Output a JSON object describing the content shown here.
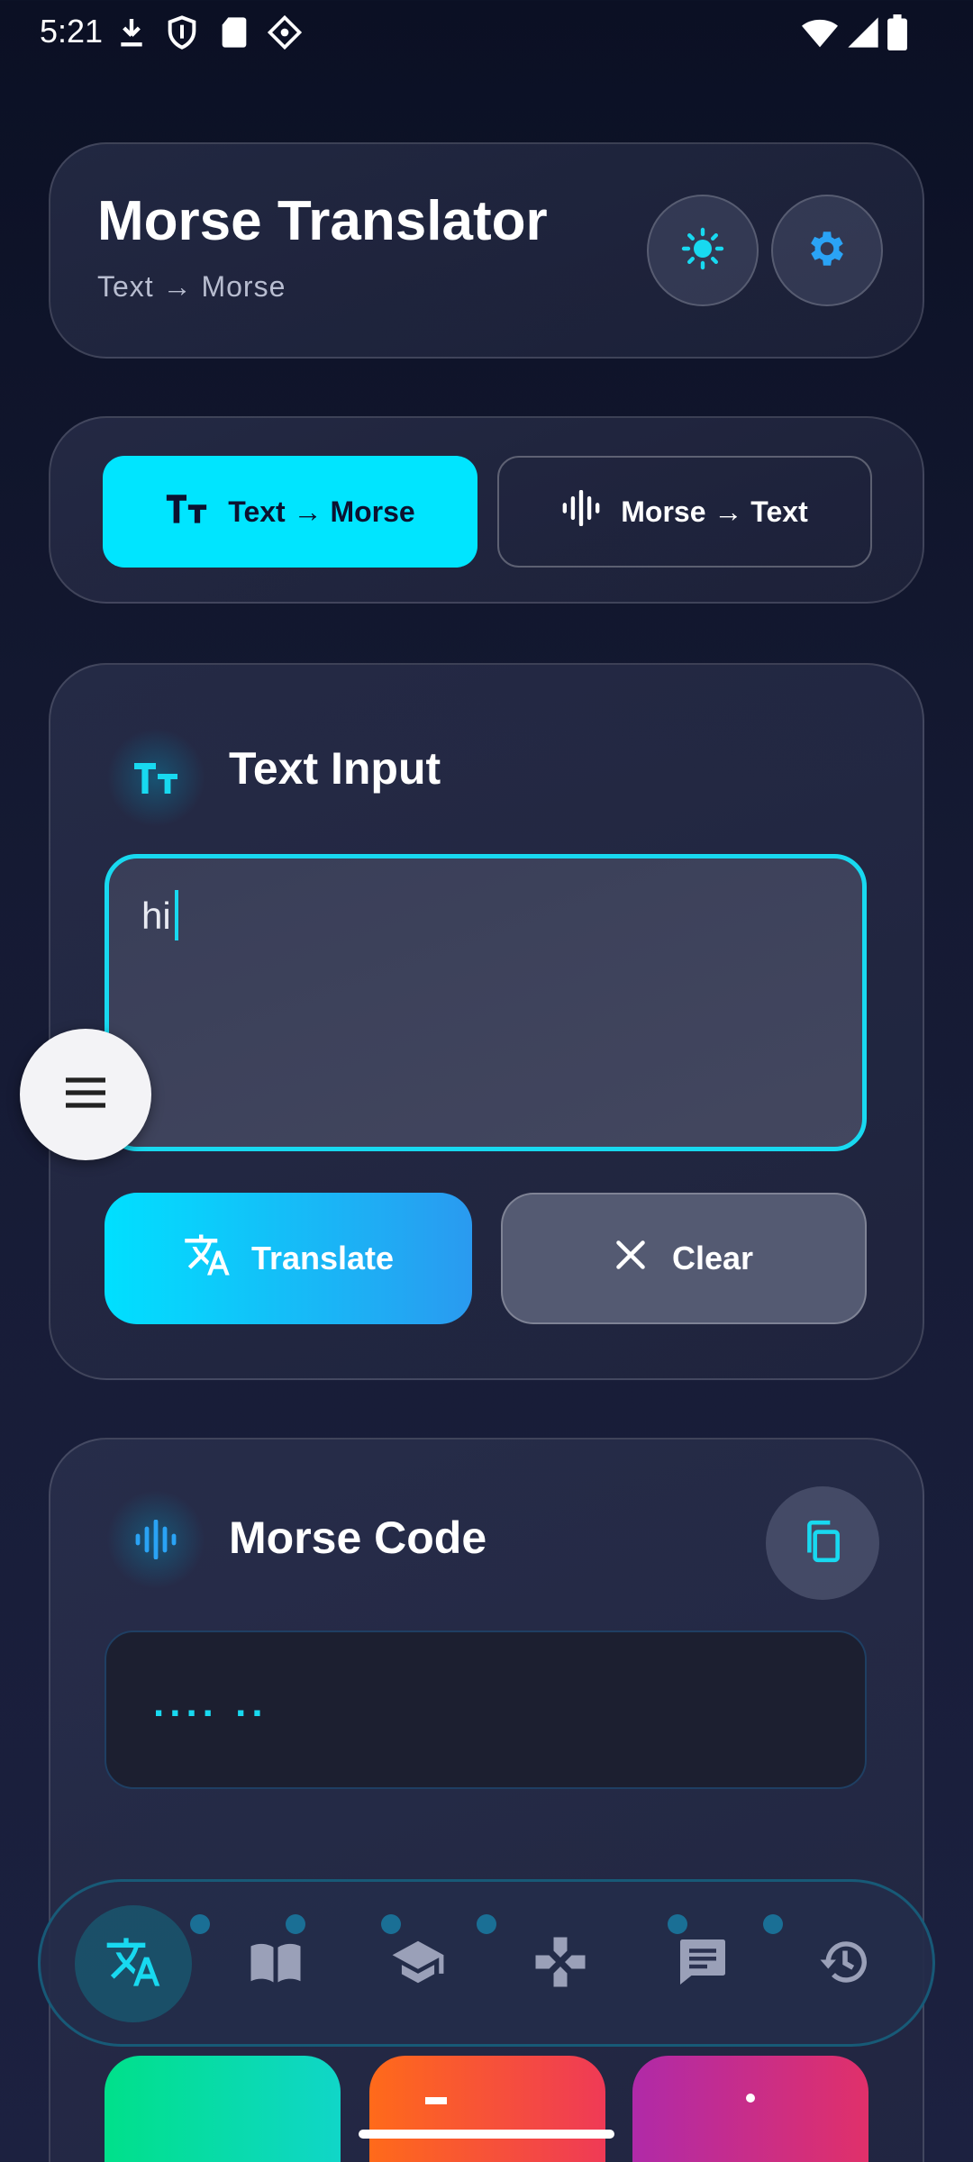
{
  "status_bar": {
    "time": "5:21",
    "left_icons": [
      "download-icon",
      "shield-icon",
      "sd-card-icon",
      "sparkle-diamond-icon"
    ],
    "right_icons": [
      "wifi-icon",
      "cell-signal-icon",
      "battery-icon"
    ]
  },
  "header": {
    "title": "Morse Translator",
    "subtitle": "Text → Morse",
    "theme_icon": "sun-icon",
    "settings_icon": "gear-icon"
  },
  "mode": {
    "text_to_morse_label": "Text → Morse",
    "morse_to_text_label": "Morse → Text",
    "active": "text_to_morse"
  },
  "input": {
    "title": "Text Input",
    "value": "hi",
    "translate_label": "Translate",
    "clear_label": "Clear"
  },
  "output": {
    "title": "Morse Code",
    "value": ".... .."
  },
  "nav": {
    "items": [
      "translate-icon",
      "book-icon",
      "school-icon",
      "game-icon",
      "chat-icon",
      "history-icon"
    ],
    "active_index": 0
  },
  "colors": {
    "accent": "#00e5ff",
    "background": "#0b1024",
    "clear_button": "#545a72"
  }
}
